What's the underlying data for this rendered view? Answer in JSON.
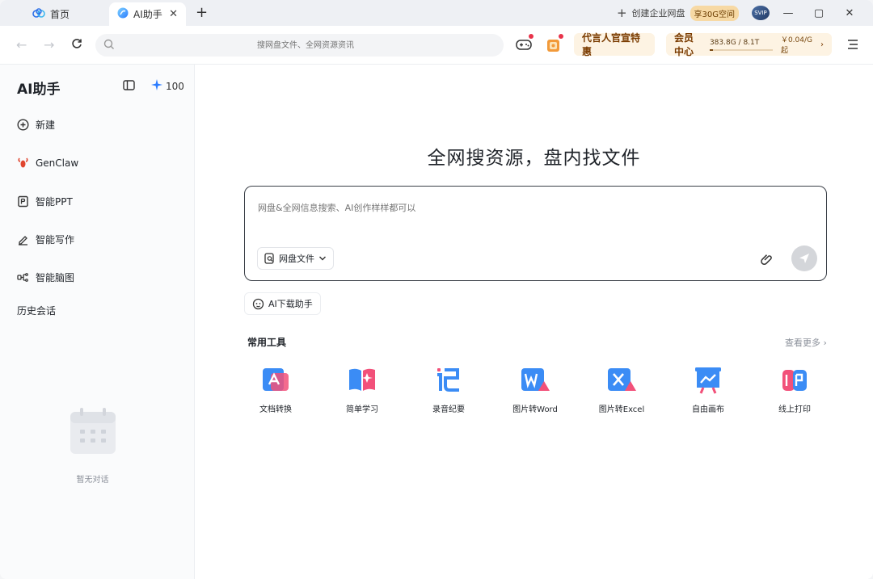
{
  "titlebar": {
    "tabs": [
      {
        "label": "首页",
        "icon": "cloud-logo-icon"
      },
      {
        "label": "AI助手",
        "icon": "ai-logo-icon"
      }
    ],
    "enterprise_label": "创建企业网盘",
    "enterprise_badge": "享30G空间",
    "svip_label": "SVIP",
    "window_controls": [
      "minimize",
      "maximize",
      "close"
    ]
  },
  "navbar": {
    "search_placeholder": "搜网盘文件、全网资源资讯",
    "promo_ad": "代言人官宣特惠",
    "vip_center": "会员中心",
    "storage_text": "383.8G / 8.1T",
    "storage_used_fraction": 0.046,
    "price_text": "￥0.04/G起"
  },
  "sidebar": {
    "title": "AI助手",
    "credits": "100",
    "items": [
      {
        "label": "新建",
        "icon": "plus-circle-icon"
      },
      {
        "label": "GenClaw",
        "icon": "lobster-icon"
      },
      {
        "label": "智能PPT",
        "icon": "ppt-icon"
      },
      {
        "label": "智能写作",
        "icon": "pen-icon"
      },
      {
        "label": "智能脑图",
        "icon": "mindmap-icon"
      }
    ],
    "history_label": "历史会话",
    "empty_text": "暂无对话"
  },
  "main": {
    "hero": "全网搜资源，盘内找文件",
    "composer_placeholder": "网盘&全网信息搜索、AI创作样样都可以",
    "scope_label": "网盘文件",
    "download_chip": "AI下载助手",
    "tools_title": "常用工具",
    "more_label": "查看更多",
    "tools": [
      {
        "label": "文档转换",
        "icon": "doc-convert-icon"
      },
      {
        "label": "简单学习",
        "icon": "book-icon"
      },
      {
        "label": "录音纪要",
        "icon": "record-notes-icon"
      },
      {
        "label": "图片转Word",
        "icon": "image-to-word-icon"
      },
      {
        "label": "图片转Excel",
        "icon": "image-to-excel-icon"
      },
      {
        "label": "自由画布",
        "icon": "canvas-icon"
      },
      {
        "label": "线上打印",
        "icon": "print-icon"
      }
    ]
  },
  "colors": {
    "accent_blue": "#2b7cff",
    "promo_bg": "#fdf3e3",
    "promo_text": "#7a3b00",
    "badge_dot": "#e8334a"
  }
}
